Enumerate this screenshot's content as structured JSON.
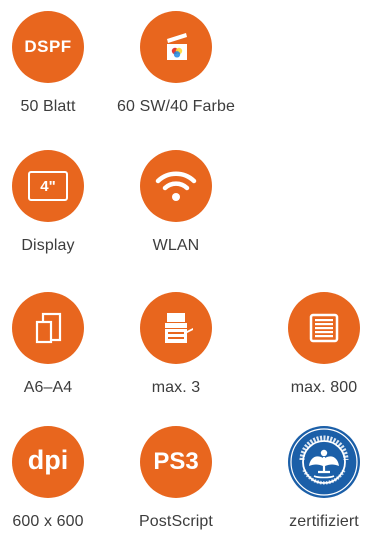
{
  "colors": {
    "accent": "#e8661e",
    "label": "#3d3d3d",
    "blue_angel": "#1b5fa8"
  },
  "features": [
    {
      "icon": "dspf-icon",
      "icon_text": "DSPF",
      "label": "50 Blatt"
    },
    {
      "icon": "color-cartridge-icon",
      "label": "60 SW/40 Farbe"
    },
    {
      "icon": "display-icon",
      "icon_text": "4\"",
      "label": "Display"
    },
    {
      "icon": "wifi-icon",
      "label": "WLAN"
    },
    {
      "icon": "paper-size-icon",
      "label": "A6–A4"
    },
    {
      "icon": "printer-icon",
      "label": "max. 3"
    },
    {
      "icon": "paper-tray-icon",
      "label": "max. 800"
    },
    {
      "icon": "dpi-icon",
      "icon_text": "dpi",
      "label": "600 x 600"
    },
    {
      "icon": "postscript-icon",
      "icon_text": "PS3",
      "label": "PostScript"
    },
    {
      "icon": "blue-angel-icon",
      "icon_text": "BLAUER ENGEL · DAS UMWELTZEICHEN",
      "label": "zertifiziert"
    }
  ]
}
